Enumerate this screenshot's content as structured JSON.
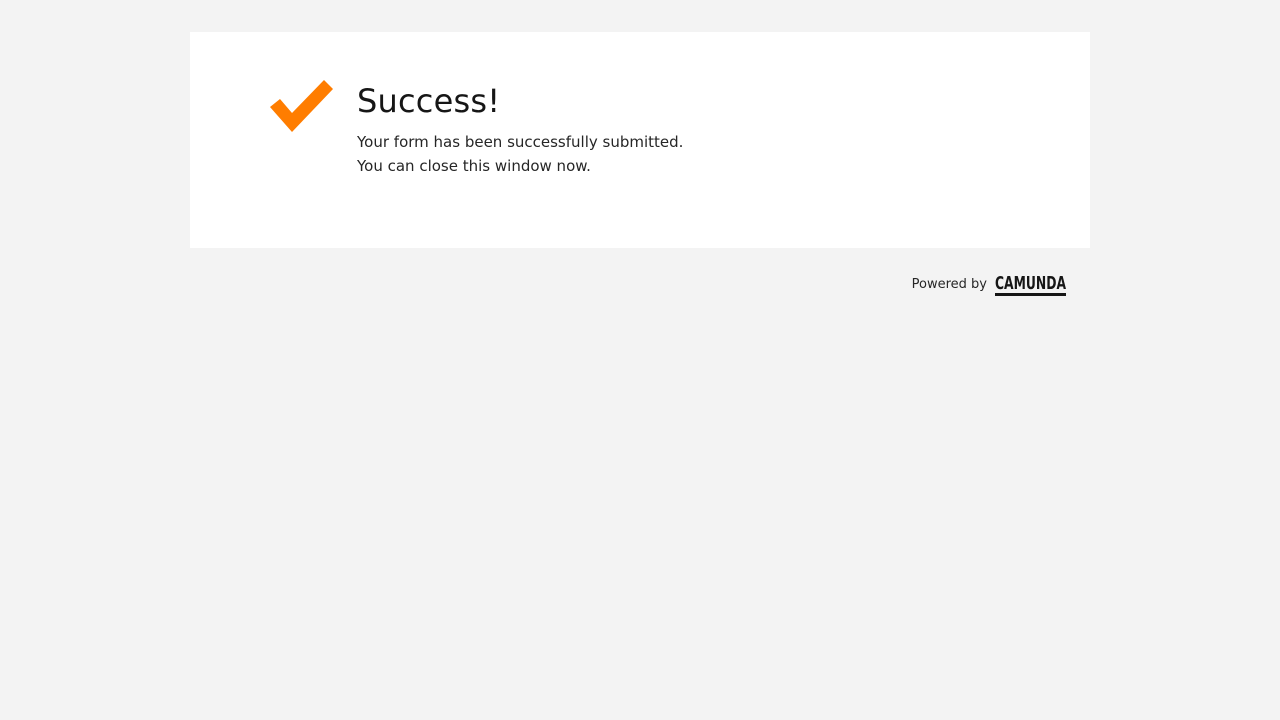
{
  "success": {
    "title": "Success!",
    "message_line1": "Your form has been successfully submitted.",
    "message_line2": "You can close this window now.",
    "icon": "checkmark-icon",
    "icon_color": "#ff7d00"
  },
  "footer": {
    "powered_by_label": "Powered by",
    "brand_logo": "camunda-logo",
    "brand_name": "CAMUNDA",
    "brand_color": "#161616"
  },
  "colors": {
    "background": "#f3f3f3",
    "card": "#ffffff"
  }
}
